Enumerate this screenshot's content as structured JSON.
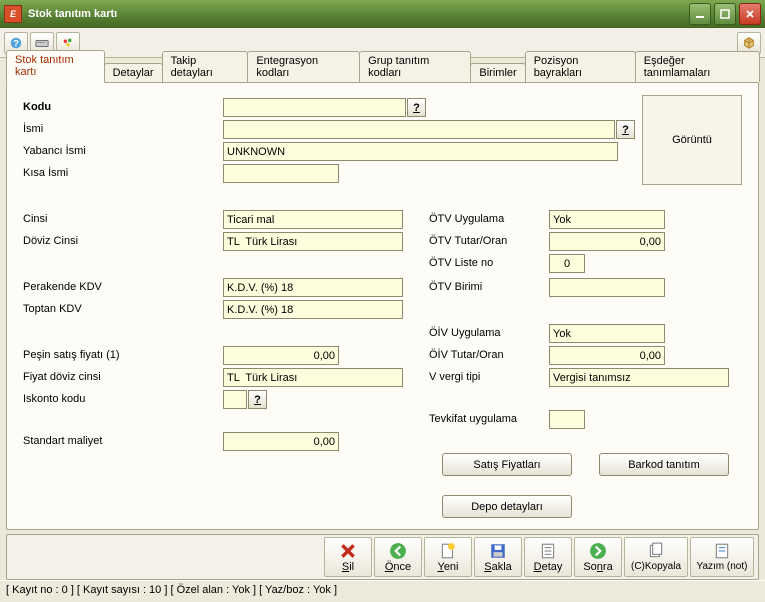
{
  "window": {
    "title": "Stok tanıtım kartı"
  },
  "tabs": [
    "Stok tanıtım kartı",
    "Detaylar",
    "Takip detayları",
    "Entegrasyon kodları",
    "Grup tanıtım kodları",
    "Birimler",
    "Pozisyon bayrakları",
    "Eşdeğer tanımlamaları"
  ],
  "labels": {
    "kodu": "Kodu",
    "ismi": "İsmi",
    "yabanci_ismi": "Yabancı İsmi",
    "kisa_ismi": "Kısa İsmi",
    "cinsi": "Cinsi",
    "doviz_cinsi": "Döviz Cinsi",
    "perakende_kdv": "Perakende KDV",
    "toptan_kdv": "Toptan KDV",
    "pesin_satis": "Peşin satış fiyatı (1)",
    "fiyat_doviz": "Fiyat döviz cinsi",
    "iskonto": "Iskonto kodu",
    "standart": "Standart maliyet",
    "otv_uyg": "ÖTV Uygulama",
    "otv_tutar": "ÖTV Tutar/Oran",
    "otv_liste": "ÖTV Liste no",
    "otv_birimi": "ÖTV Birimi",
    "oiv_uyg": "ÖİV Uygulama",
    "oiv_tutar": "ÖİV Tutar/Oran",
    "v_vergi": "V vergi tipi",
    "tevkifat": "Tevkifat uygulama",
    "goruntu": "Görüntü"
  },
  "values": {
    "kodu": "",
    "ismi": "",
    "yabanci_ismi": "UNKNOWN",
    "kisa_ismi": "",
    "cinsi": "Ticari mal",
    "doviz_cinsi": "TL  Türk Lirası",
    "perakende_kdv": "K.D.V. (%) 18",
    "toptan_kdv": "K.D.V. (%) 18",
    "pesin_satis": "0,00",
    "fiyat_doviz": "TL  Türk Lirası",
    "iskonto": "",
    "standart": "0,00",
    "otv_uyg": "Yok",
    "otv_tutar": "0,00",
    "otv_liste": "0",
    "otv_birimi": "",
    "oiv_uyg": "Yok",
    "oiv_tutar": "0,00",
    "v_vergi": "Vergisi tanımsız",
    "tevkifat": ""
  },
  "buttons": {
    "satis_fiyatlari": "Satış Fiyatları",
    "barkod": "Barkod tanıtım",
    "depo": "Depo detayları",
    "sil": "Sil",
    "once": "Önce",
    "yeni": "Yeni",
    "sakla": "Sakla",
    "detay": "Detay",
    "sonra": "Sonra",
    "kopyala": "(C)Kopyala",
    "yazim": "Yazım (not)"
  },
  "status": "[ Kayıt no : 0 ] [ Kayıt sayısı : 10 ] [ Özel alan : Yok ] [ Yaz/boz : Yok ]",
  "q": "?"
}
